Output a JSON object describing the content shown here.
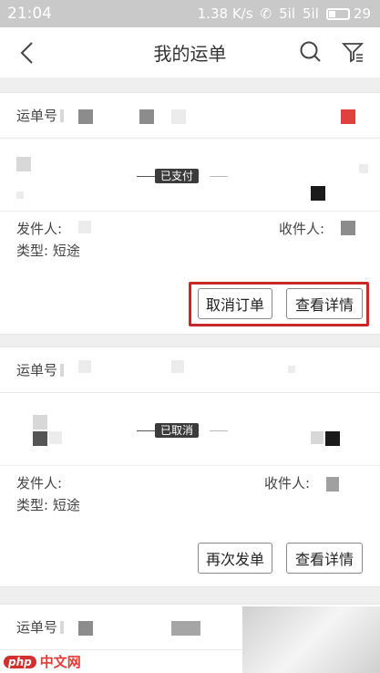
{
  "status_bar": {
    "time": "21:04",
    "speed": "1.38 K/s",
    "signal1": "5il",
    "signal2": "5il",
    "battery": "29"
  },
  "navbar": {
    "title": "我的运单"
  },
  "orders": [
    {
      "id_label": "运单号",
      "status": "已支付",
      "sender_label": "发件人:",
      "receiver_label": "收件人:",
      "type_label": "类型:",
      "type_value": "短途",
      "actions": [
        "取消订单",
        "查看详情"
      ]
    },
    {
      "id_label": "运单号",
      "status": "已取消",
      "sender_label": "发件人:",
      "receiver_label": "收件人:",
      "type_label": "类型:",
      "type_value": "短途",
      "actions": [
        "再次发单",
        "查看详情"
      ]
    },
    {
      "id_label": "运单号"
    }
  ],
  "watermark": {
    "badge": "php",
    "text": "中文网"
  },
  "colors": {
    "highlight": "#c8282a",
    "status_bg": "#3b3b3b",
    "accent_red": "#e0403e"
  }
}
